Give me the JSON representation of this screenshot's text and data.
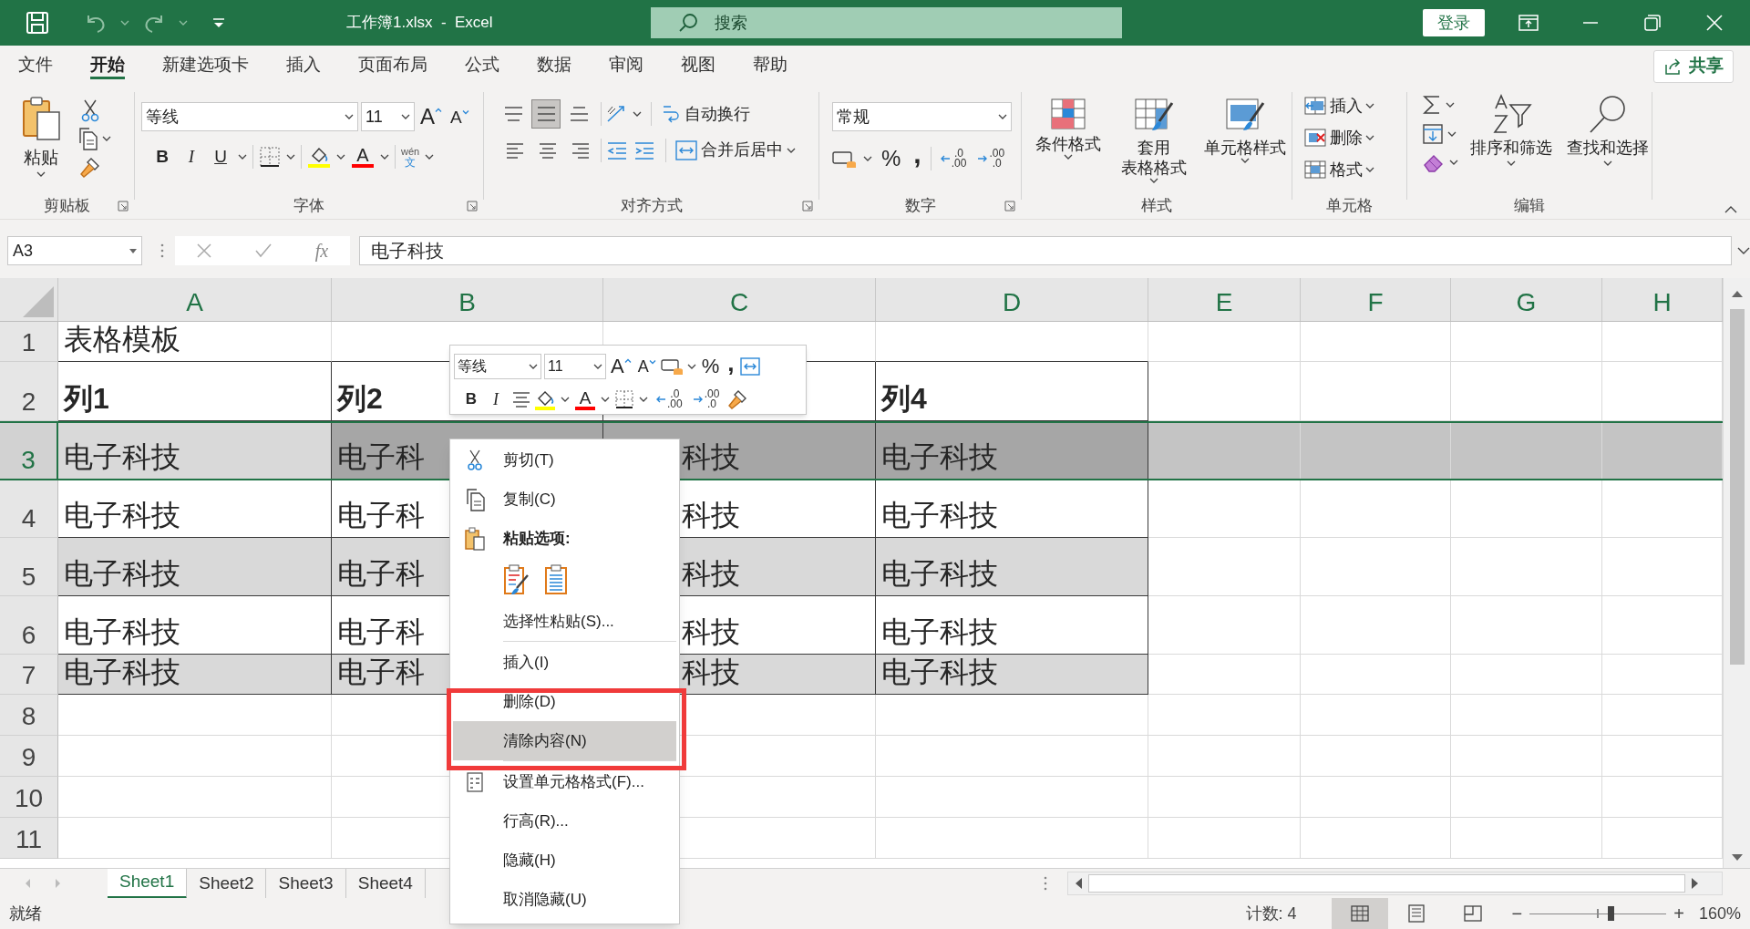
{
  "title_bar": {
    "title": "工作簿1.xlsx  -  Excel",
    "search_placeholder": "搜索",
    "sign_in": "登录"
  },
  "menu_tabs": [
    {
      "label": "文件",
      "selected": false
    },
    {
      "label": "开始",
      "selected": true
    },
    {
      "label": "新建选项卡",
      "selected": false
    },
    {
      "label": "插入",
      "selected": false
    },
    {
      "label": "页面布局",
      "selected": false
    },
    {
      "label": "公式",
      "selected": false
    },
    {
      "label": "数据",
      "selected": false
    },
    {
      "label": "审阅",
      "selected": false
    },
    {
      "label": "视图",
      "selected": false
    },
    {
      "label": "帮助",
      "selected": false
    }
  ],
  "share": "共享",
  "ribbon": {
    "clipboard": {
      "paste": "粘贴",
      "label": "剪贴板"
    },
    "font": {
      "name": "等线",
      "size": "11",
      "grow": "A",
      "shrink": "A",
      "bold": "B",
      "italic": "I",
      "underline": "U",
      "color_letter": "A",
      "phonetic": "wén",
      "phonetic_char": "文",
      "label": "字体"
    },
    "alignment": {
      "vertical_buttons": [
        {
          "selected": false
        },
        {
          "selected": true
        },
        {
          "selected": false
        }
      ],
      "wrap": "自动换行",
      "merge": "合并后居中",
      "label": "对齐方式"
    },
    "number": {
      "format": "常规",
      "percent": "%",
      "comma": ",",
      "increase_decimal": {
        "top": ".0",
        "bottom": ".00"
      },
      "decrease_decimal": {
        "top": ".00",
        "bottom": ".0"
      },
      "label": "数字"
    },
    "styles": {
      "buttons": [
        {
          "lines": [
            "条件格式"
          ]
        },
        {
          "lines": [
            "套用",
            "表格格式"
          ]
        },
        {
          "lines": [
            "单元格样式"
          ]
        }
      ],
      "label": "样式"
    },
    "cells": {
      "buttons": [
        "插入",
        "删除",
        "格式"
      ],
      "label": "单元格"
    },
    "editing": {
      "buttons": [
        "排序和筛选",
        "查找和选择"
      ],
      "label": "编辑"
    }
  },
  "formula_bar": {
    "name_box": "A3",
    "fx": "fx",
    "content": "电子科技"
  },
  "columns": [
    "A",
    "B",
    "C",
    "D",
    "E",
    "F",
    "G",
    "H"
  ],
  "rows": [
    {
      "header": "1",
      "kind": "title",
      "selected": false,
      "cells": {
        "A": "表格模板"
      }
    },
    {
      "header": "2",
      "kind": "header",
      "selected": false,
      "cells": {
        "A": "列1",
        "B": "列2",
        "D": "列4"
      }
    },
    {
      "header": "3",
      "kind": "band",
      "selected": true,
      "cells": {
        "A": "电子科技",
        "B": "电子科",
        "C": "科技",
        "D": "电子科技"
      }
    },
    {
      "header": "4",
      "kind": "body",
      "selected": false,
      "cells": {
        "A": "电子科技",
        "B": "电子科",
        "C": "科技",
        "D": "电子科技"
      }
    },
    {
      "header": "5",
      "kind": "band",
      "selected": false,
      "cells": {
        "A": "电子科技",
        "B": "电子科",
        "C": "科技",
        "D": "电子科技"
      }
    },
    {
      "header": "6",
      "kind": "body",
      "selected": false,
      "cells": {
        "A": "电子科技",
        "B": "电子科",
        "C": "科技",
        "D": "电子科技"
      }
    },
    {
      "header": "7",
      "kind": "band",
      "selected": false,
      "cells": {
        "A": "电子科技",
        "B": "电子科",
        "C": "科技",
        "D": "电子科技"
      }
    },
    {
      "header": "8",
      "kind": "empty",
      "selected": false,
      "cells": {}
    },
    {
      "header": "9",
      "kind": "empty",
      "selected": false,
      "cells": {}
    },
    {
      "header": "10",
      "kind": "empty",
      "selected": false,
      "cells": {}
    },
    {
      "header": "11",
      "kind": "empty",
      "selected": false,
      "cells": {}
    }
  ],
  "mini_toolbar": {
    "font": "等线",
    "size": "11",
    "grow": "A",
    "shrink": "A",
    "percent": "%",
    "comma": ",",
    "bold": "B",
    "italic": "I",
    "color_letter": "A",
    "increase_decimal": {
      "top": ".0",
      "bottom": ".00"
    },
    "decrease_decimal": {
      "top": ".00",
      "bottom": ".0"
    }
  },
  "context_menu": [
    {
      "kind": "command",
      "label": "剪切(T)",
      "selected": false
    },
    {
      "kind": "command",
      "label": "复制(C)",
      "selected": false
    },
    {
      "kind": "heading",
      "label": "粘贴选项:"
    },
    {
      "kind": "paste-options"
    },
    {
      "kind": "command",
      "label": "选择性粘贴(S)...",
      "selected": false
    },
    {
      "kind": "separator"
    },
    {
      "kind": "command",
      "label": "插入(I)",
      "selected": false
    },
    {
      "kind": "command",
      "label": "删除(D)",
      "selected": false
    },
    {
      "kind": "command",
      "label": "清除内容(N)",
      "selected": true
    },
    {
      "kind": "separator"
    },
    {
      "kind": "command",
      "label": "设置单元格格式(F)...",
      "selected": false
    },
    {
      "kind": "command",
      "label": "行高(R)...",
      "selected": false
    },
    {
      "kind": "command",
      "label": "隐藏(H)",
      "selected": false
    },
    {
      "kind": "command",
      "label": "取消隐藏(U)",
      "selected": false
    }
  ],
  "sheets": [
    {
      "label": "Sheet1",
      "selected": true
    },
    {
      "label": "Sheet2",
      "selected": false
    },
    {
      "label": "Sheet3",
      "selected": false
    },
    {
      "label": "Sheet4",
      "selected": false
    }
  ],
  "status_bar": {
    "status": "就绪",
    "count": "计数: 4",
    "views": [
      {
        "selected": true
      },
      {
        "selected": false
      },
      {
        "selected": false
      }
    ],
    "zoom": {
      "minus": "−",
      "plus": "+",
      "level": 0.57,
      "value": "160%"
    }
  }
}
